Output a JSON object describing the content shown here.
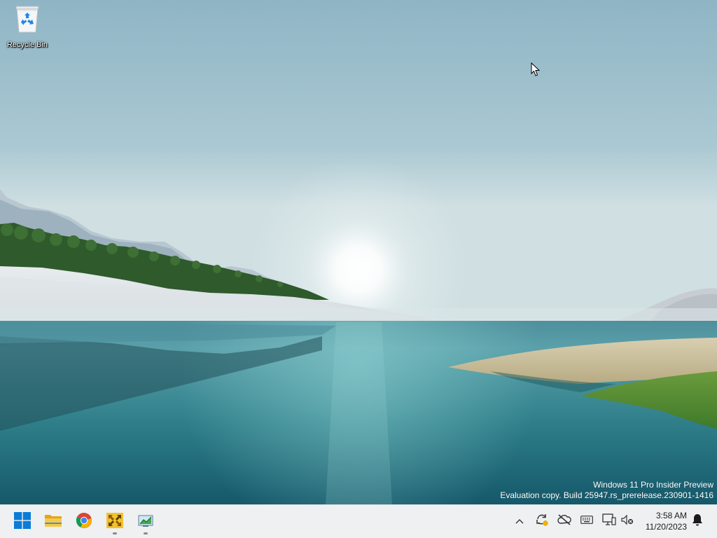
{
  "desktop": {
    "icons": [
      {
        "label": "Recycle Bin",
        "icon": "recycle-bin-icon"
      }
    ]
  },
  "watermark": {
    "line1": "Windows 11 Pro Insider Preview",
    "line2": "Evaluation copy. Build 25947.rs_prerelease.230901-1416"
  },
  "taskbar": {
    "apps": [
      {
        "name": "Start",
        "icon": "windows-start-icon",
        "running": false
      },
      {
        "name": "File Explorer",
        "icon": "file-explorer-icon",
        "running": false
      },
      {
        "name": "Google Chrome",
        "icon": "chrome-icon",
        "running": false
      },
      {
        "name": "App",
        "icon": "yellow-arrows-app-icon",
        "running": true
      },
      {
        "name": "App",
        "icon": "green-chart-app-icon",
        "running": true
      }
    ],
    "tray": {
      "icons": [
        "chevron-up-icon",
        "sync-icon",
        "cloud-offline-icon",
        "keyboard-icon",
        "display-icon",
        "volume-muted-icon",
        "notification-bell-icon"
      ]
    },
    "clock": {
      "time": "3:58 AM",
      "date": "11/20/2023"
    }
  },
  "colors": {
    "taskbar_bg": "#eef0f2",
    "windows_blue": "#0a7cd8",
    "sky_top": "#8fb6c6",
    "water": "#2d7d88"
  }
}
